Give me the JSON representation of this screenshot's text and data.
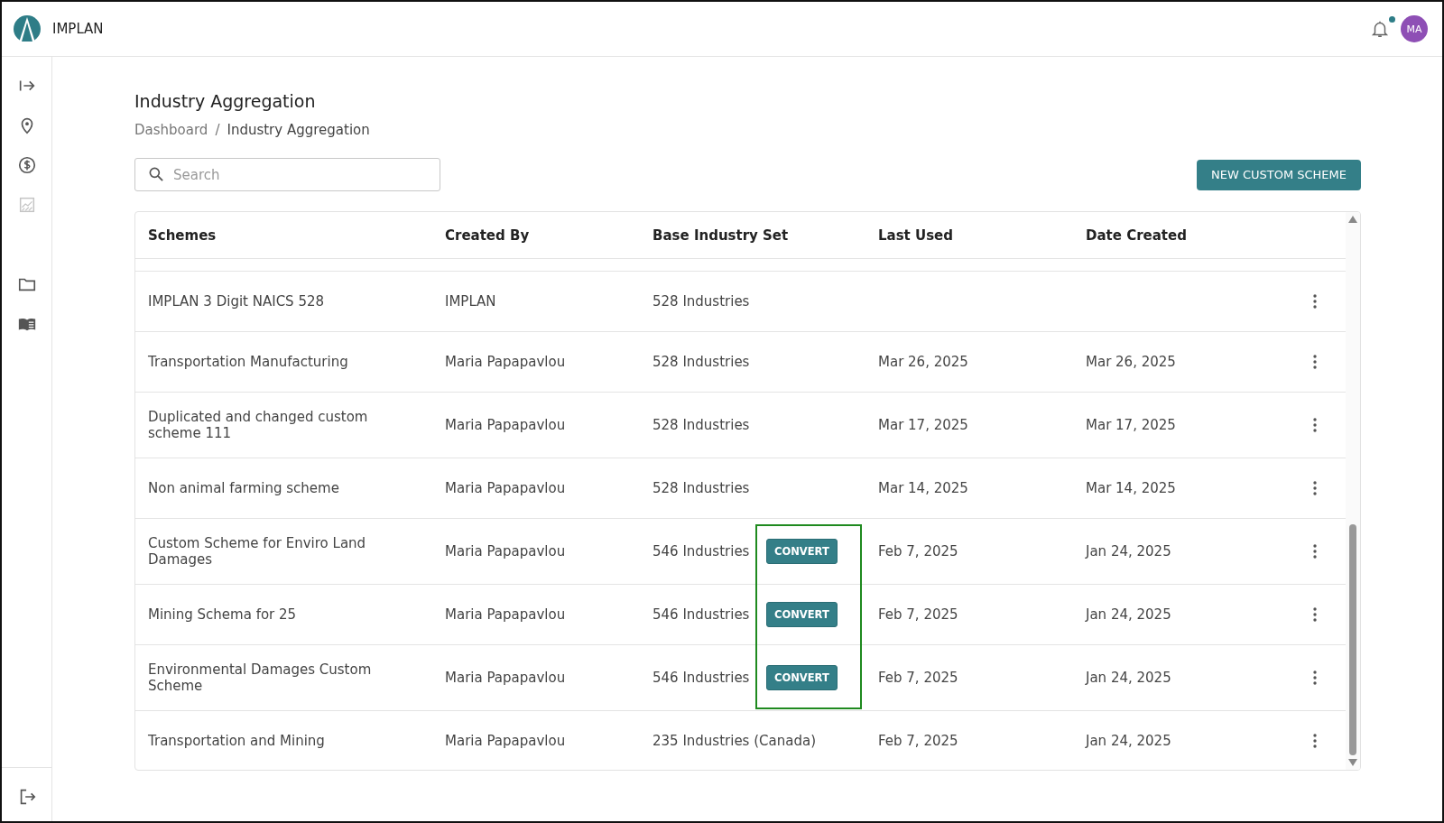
{
  "app": {
    "name": "IMPLAN"
  },
  "header": {
    "notification_unread": true,
    "avatar_initials": "MA"
  },
  "sidebar": {
    "items": [
      {
        "kind": "expand",
        "disabled": false
      },
      {
        "kind": "location",
        "disabled": false
      },
      {
        "kind": "dollar",
        "disabled": false
      },
      {
        "kind": "chart",
        "disabled": true
      },
      {
        "kind": "folder",
        "disabled": false
      },
      {
        "kind": "book",
        "disabled": false
      }
    ],
    "bottom": {
      "kind": "logout"
    }
  },
  "page": {
    "title": "Industry Aggregation",
    "breadcrumb": [
      "Dashboard",
      "Industry Aggregation"
    ],
    "breadcrumb_separator": "/"
  },
  "search": {
    "placeholder": "Search"
  },
  "new_button": "NEW CUSTOM SCHEME",
  "table": {
    "columns": [
      "Schemes",
      "Created By",
      "Base Industry Set",
      "Last Used",
      "Date Created"
    ],
    "rows": [
      {
        "scheme": "IMPLAN 3 Digit NAICS 528",
        "created_by": "IMPLAN",
        "base_set": "528 Industries",
        "action": null,
        "highlighted": false
      },
      {
        "scheme": "Transportation Manufacturing",
        "created_by": "Maria Papapavlou",
        "base_set": "528 Industries",
        "action": null,
        "last_used": "Mar 26, 2025",
        "date_created": "Mar 26, 2025",
        "highlighted": false
      },
      {
        "scheme": "Duplicated and changed custom scheme 111",
        "created_by": "Maria Papapavlou",
        "base_set": "528 Industries",
        "action": null,
        "last_used": "Mar 17, 2025",
        "date_created": "Mar 17, 2025",
        "highlighted": false
      },
      {
        "scheme": "Non animal farming scheme",
        "created_by": "Maria Papapavlou",
        "base_set": "528 Industries",
        "action": null,
        "last_used": "Mar 14, 2025",
        "date_created": "Mar 14, 2025",
        "highlighted": false
      },
      {
        "scheme": "Custom Scheme for Enviro Land Damages",
        "created_by": "Maria Papapavlou",
        "base_set": "546 Industries",
        "action": "CONVERT",
        "last_used": "Feb 7, 2025",
        "date_created": "Jan 24, 2025",
        "highlighted": true
      },
      {
        "scheme": "Mining Schema for 25",
        "created_by": "Maria Papapavlou",
        "base_set": "546 Industries",
        "action": "CONVERT",
        "last_used": "Feb 7, 2025",
        "date_created": "Jan 24, 2025",
        "highlighted": true
      },
      {
        "scheme": "Environmental Damages Custom Scheme",
        "created_by": "Maria Papapavlou",
        "base_set": "546 Industries",
        "action": "CONVERT",
        "last_used": "Feb 7, 2025",
        "date_created": "Jan 24, 2025",
        "highlighted": true
      },
      {
        "scheme": "Transportation and Mining",
        "created_by": "Maria Papapavlou",
        "base_set": "235 Industries (Canada)",
        "action": null,
        "last_used": "Feb 7, 2025",
        "date_created": "Jan 24, 2025",
        "highlighted": false
      }
    ]
  }
}
